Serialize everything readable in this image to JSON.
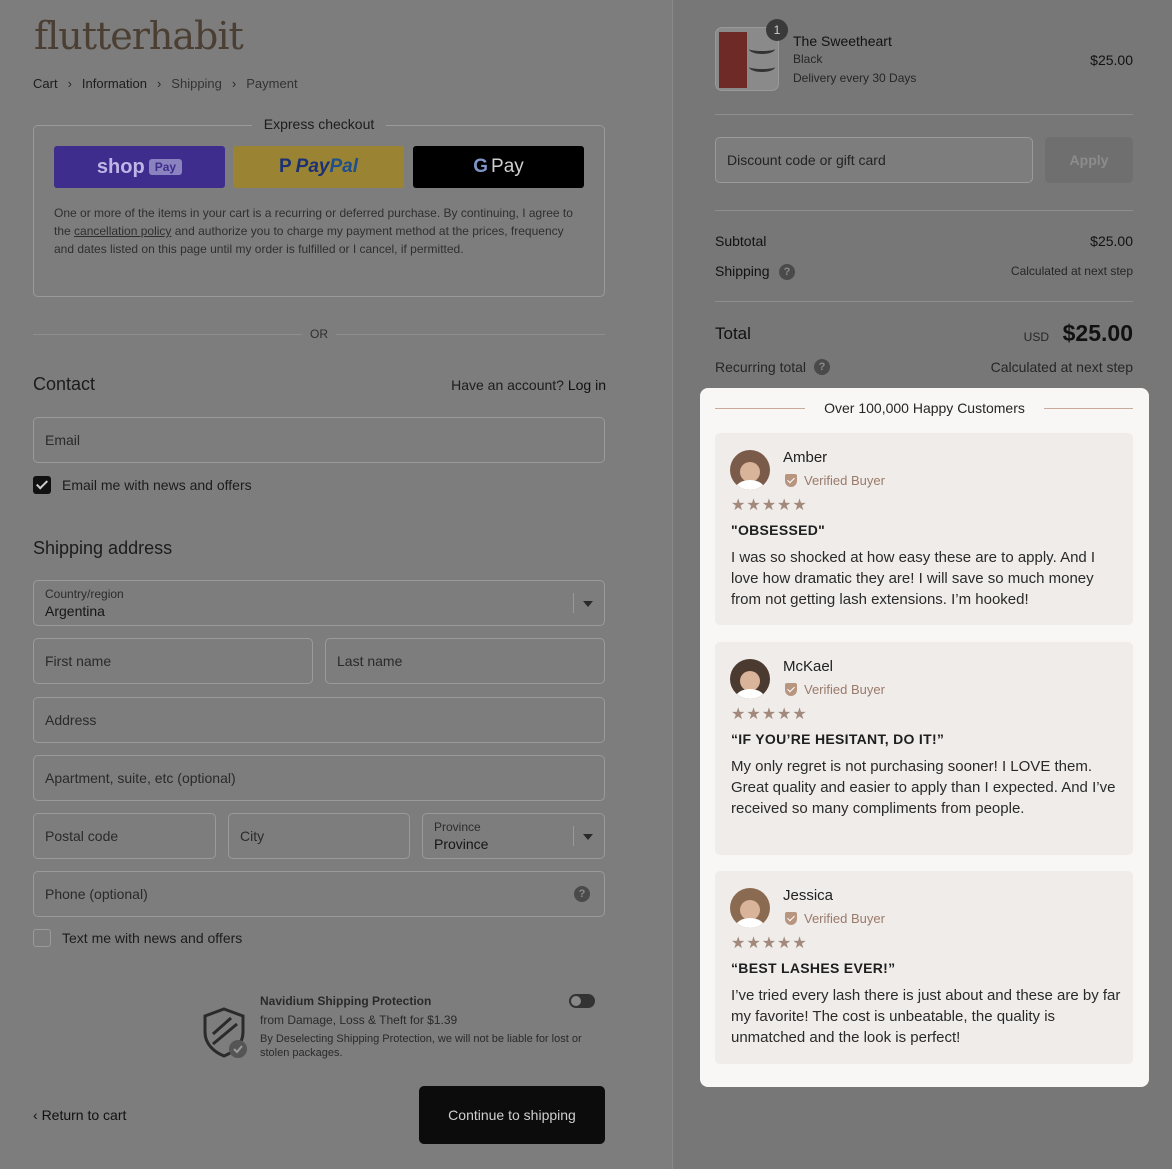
{
  "brand": {
    "logo_text": "flutterhabit"
  },
  "breadcrumb": [
    {
      "label": "Cart"
    },
    {
      "label": "Information"
    },
    {
      "label": "Shipping"
    },
    {
      "label": "Payment"
    }
  ],
  "express_checkout": {
    "title": "Express checkout",
    "shop_pay_label": "shop",
    "shop_pay_pill": "Pay",
    "paypal_label_pay": "Pay",
    "paypal_label_pal": "Pal",
    "gpay_g": "G",
    "gpay_label": "Pay",
    "note_before": "One or more of the items in your cart is a recurring or deferred purchase. By continuing, I agree to the ",
    "note_link": "cancellation policy",
    "note_after": " and authorize you to charge my payment method at the prices, frequency and dates listed on this page until my order is fulfilled or I cancel, if permitted."
  },
  "or_label": "OR",
  "contact": {
    "title": "Contact",
    "have_account": "Have an account?",
    "login": "Log in",
    "email_placeholder": "Email",
    "news_label": "Email me with news and offers",
    "news_checked": true
  },
  "shipping": {
    "title": "Shipping address",
    "country_label": "Country/region",
    "country_value": "Argentina",
    "first_name": "First name",
    "last_name": "Last name",
    "address": "Address",
    "apartment": "Apartment, suite, etc (optional)",
    "postal": "Postal code",
    "city": "City",
    "province_label": "Province",
    "province_value": "Province",
    "phone": "Phone (optional)",
    "text_label": "Text me with news and offers",
    "text_checked": false
  },
  "protection": {
    "title": "Navidium Shipping Protection",
    "subtitle": "from Damage, Loss & Theft for $1.39",
    "note": "By Deselecting Shipping Protection, we will not be liable for lost or stolen packages.",
    "enabled": false
  },
  "footer": {
    "return_label": "Return to cart",
    "continue_label": "Continue to shipping"
  },
  "order": {
    "qty": "1",
    "product_name": "The Sweetheart",
    "variant": "Black",
    "delivery": "Delivery every 30 Days",
    "price": "$25.00",
    "discount_placeholder": "Discount code or gift card",
    "apply_label": "Apply",
    "subtotal_label": "Subtotal",
    "subtotal_value": "$25.00",
    "shipping_label": "Shipping",
    "shipping_value": "Calculated at next step",
    "total_label": "Total",
    "currency": "USD",
    "total_value": "$25.00",
    "recurring_label": "Recurring total",
    "recurring_value": "Calculated at next step"
  },
  "reviews": {
    "heading": "Over 100,000 Happy Customers",
    "verified_label": "Verified Buyer",
    "stars": "★★★★★",
    "items": [
      {
        "name": "Amber",
        "title": "\"OBSESSED\"",
        "body": "I was so shocked at how easy these are to apply. And I love how dramatic they are! I will save so much money from not getting lash extensions. I’m hooked!"
      },
      {
        "name": "McKael",
        "title": "“IF YOU’RE HESITANT, DO IT!”",
        "body": "My only regret is not purchasing sooner! I LOVE them. Great quality and easier to apply than I expected. And I’ve received so many compliments from people."
      },
      {
        "name": "Jessica",
        "title": "“BEST LASHES EVER!”",
        "body": "I’ve tried every lash there is just about and these are by far my favorite! The cost is unbeatable, the quality is unmatched and the look is perfect!"
      }
    ]
  }
}
